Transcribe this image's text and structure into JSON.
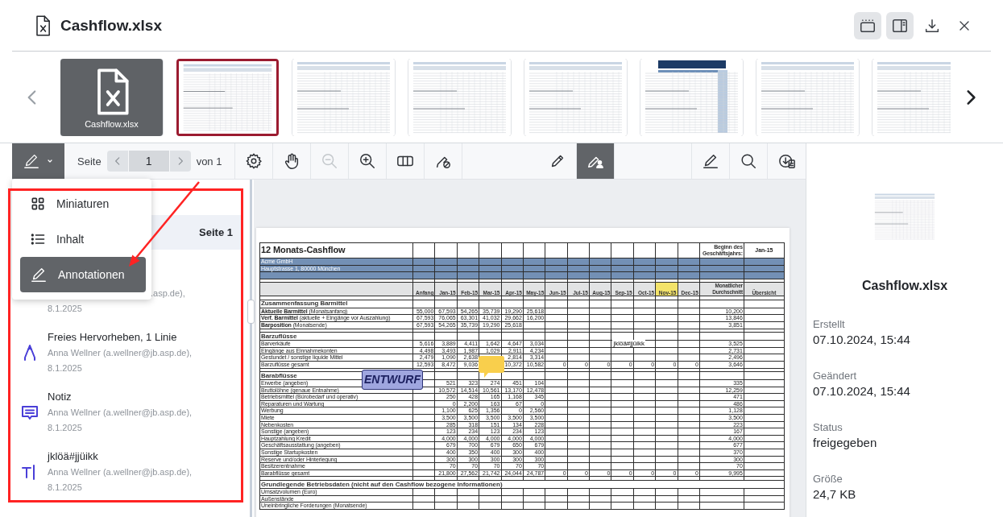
{
  "header": {
    "title": "Cashflow.xlsx",
    "toggles": [
      {
        "kind": "strip",
        "on": true
      },
      {
        "kind": "panel",
        "on": true
      }
    ]
  },
  "strip": {
    "items": [
      {
        "kind": "file",
        "label": "Cashflow.xlsx",
        "selected": false
      },
      {
        "kind": "sheet",
        "selected": true
      },
      {
        "kind": "sheet",
        "selected": false
      },
      {
        "kind": "sheet",
        "selected": false
      },
      {
        "kind": "sheet",
        "selected": false
      },
      {
        "kind": "banner",
        "selected": false
      },
      {
        "kind": "sheet",
        "selected": false
      },
      {
        "kind": "sheet",
        "selected": false
      }
    ]
  },
  "toolbar": {
    "mode": {
      "expanded": true
    },
    "page_label": "Seite",
    "page_value": "1",
    "page_total": "von 1",
    "groups": [
      {
        "tools": [
          {
            "kind": "settings",
            "disabled": false,
            "selected": false
          },
          {
            "kind": "hand",
            "disabled": false,
            "selected": false
          },
          {
            "kind": "zoom-out",
            "disabled": true,
            "selected": false
          },
          {
            "kind": "zoom-in",
            "disabled": false,
            "selected": false
          },
          {
            "kind": "columns",
            "disabled": false,
            "selected": false
          },
          {
            "kind": "pen-blocked",
            "disabled": false,
            "selected": false
          }
        ]
      },
      {
        "tools": [
          {
            "kind": "pencil",
            "disabled": false,
            "selected": false
          },
          {
            "kind": "pencil-person",
            "disabled": false,
            "selected": true
          }
        ]
      },
      {
        "tools": [
          {
            "kind": "pencil-line",
            "disabled": false,
            "selected": false
          },
          {
            "kind": "search",
            "disabled": false,
            "selected": false
          },
          {
            "kind": "download-document",
            "disabled": false,
            "selected": false
          }
        ]
      }
    ]
  },
  "menu": {
    "items": [
      {
        "kind": "grid",
        "label": "Miniaturen",
        "selected": false
      },
      {
        "kind": "list",
        "label": "Inhalt",
        "selected": false
      },
      {
        "kind": "pen",
        "label": "Annotationen",
        "selected": true
      }
    ]
  },
  "sidebar": {
    "page_header": "Seite 1",
    "annotations": [
      {
        "kind": "covered",
        "author": ".asp.de),",
        "date": "8.1.2025"
      },
      {
        "kind": "ink",
        "title": "Freies Hervorheben, 1 Linie",
        "author": "Anna Wellner (a.wellner@jb.asp.de),",
        "date": "8.1.2025"
      },
      {
        "kind": "note",
        "title": "Notiz",
        "author": "Anna Wellner (a.wellner@jb.asp.de),",
        "date": "8.1.2025"
      },
      {
        "kind": "text",
        "title": "jklöä#jjüikk",
        "author": "Anna Wellner (a.wellner@jb.asp.de),",
        "date": "8.1.2025"
      }
    ]
  },
  "sheet": {
    "rows": [
      {
        "kind": "title",
        "label": "12 Monats-Cashflow",
        "average": "Beginn des Geschäftsjahrs:",
        "overview": "Jan-15"
      },
      {
        "kind": "band",
        "label": "Acme GmbH"
      },
      {
        "kind": "band",
        "label": "Hauptstrasse 1, 80000 München"
      },
      {
        "kind": "band"
      },
      {
        "kind": "blank"
      },
      {
        "kind": "header",
        "cells": [
          {
            "text": "Anfang",
            "highlighted": false
          },
          {
            "text": "Jan-15",
            "highlighted": false
          },
          {
            "text": "Feb-15",
            "highlighted": false
          },
          {
            "text": "Mar-15",
            "highlighted": false
          },
          {
            "text": "Apr-15",
            "highlighted": false
          },
          {
            "text": "May-15",
            "highlighted": false
          },
          {
            "text": "Jun-15",
            "highlighted": false
          },
          {
            "text": "Jul-15",
            "highlighted": false
          },
          {
            "text": "Aug-15",
            "highlighted": false
          },
          {
            "text": "Sep-15",
            "highlighted": false
          },
          {
            "text": "Oct-15",
            "highlighted": false
          },
          {
            "text": "Nov-15",
            "highlighted": true
          },
          {
            "text": "Dec-15",
            "highlighted": false
          }
        ],
        "average": "Monatlicher Durchschnitt",
        "overview": "Übersicht"
      },
      {
        "kind": "blank"
      },
      {
        "kind": "section",
        "label": "Zusammenfassung Barmittel"
      },
      {
        "kind": "data",
        "label": "**Aktuelle Barmittel** (Monatsanfang)",
        "cells": [
          "55,000",
          "67,593",
          "54,265",
          "35,739",
          "19,290",
          "25,618",
          null,
          null,
          null,
          null,
          null,
          null,
          null
        ],
        "average": "10,200"
      },
      {
        "kind": "data",
        "label": "**Verf. Barmittel** (aktuelle + Eingänge vor Auszahlung)",
        "cells": [
          "67,593",
          "76,065",
          "63,301",
          "41,032",
          "29,662",
          "16,200",
          null,
          null,
          null,
          null,
          null,
          null,
          null
        ],
        "average": "13,846"
      },
      {
        "kind": "data",
        "label": "**Barposition** (Monatsende)",
        "cells": [
          "67,593",
          "54,265",
          "35,739",
          "19,290",
          "25,618",
          null,
          null,
          null,
          null,
          null,
          null,
          null,
          null
        ],
        "average": "3,851"
      },
      {
        "kind": "blank"
      },
      {
        "kind": "section",
        "label": "Barzuflüsse"
      },
      {
        "kind": "data",
        "label": "Barverkäufe",
        "cells": [
          "5,616",
          "3,889",
          "4,411",
          "1,642",
          "4,647",
          "3,034",
          null,
          null,
          null,
          null,
          null,
          null,
          null
        ],
        "average": "3,525"
      },
      {
        "kind": "data",
        "label": "Eingänge aus Einnahmekonten",
        "cells": [
          "4,498",
          "3,493",
          "1,987",
          "1,029",
          "2,911",
          "4,234",
          null,
          null,
          null,
          null,
          null,
          null,
          null
        ],
        "average": "2,731"
      },
      {
        "kind": "data",
        "label": "Gestundet / sonstige liquide Mittel",
        "cells": [
          "2,479",
          "1,090",
          "2,638",
          null,
          "2,814",
          "3,314",
          null,
          null,
          null,
          null,
          null,
          null,
          null
        ],
        "average": "2,496"
      },
      {
        "kind": "data",
        "label": "Barzuflüsse gesamt",
        "cells": [
          "12,593",
          "8,472",
          "9,036",
          null,
          "10,372",
          "10,582",
          "0",
          "0",
          "0",
          "0",
          "0",
          "0",
          "0"
        ],
        "average": "3,646"
      },
      {
        "kind": "blank"
      },
      {
        "kind": "section",
        "label": "Barabflüsse"
      },
      {
        "kind": "data",
        "label": "Erwerbe (angeben)",
        "cells": [
          null,
          "521",
          "323",
          "274",
          "451",
          "104",
          null,
          null,
          null,
          null,
          null,
          null,
          null
        ],
        "average": "335"
      },
      {
        "kind": "data",
        "label": "Bruttolöhne (genaue Entnahme)",
        "cells": [
          null,
          "10,572",
          "14,514",
          "10,561",
          "13,170",
          "12,478",
          null,
          null,
          null,
          null,
          null,
          null,
          null
        ],
        "average": "12,259"
      },
      {
        "kind": "data",
        "label": "Betriebsmittel (Bürobedarf und operativ)",
        "cells": [
          null,
          "250",
          "428",
          "165",
          "1,168",
          "345",
          null,
          null,
          null,
          null,
          null,
          null,
          null
        ],
        "average": "471"
      },
      {
        "kind": "data",
        "label": "Reparaturen und Wartung",
        "cells": [
          null,
          "0",
          "2,200",
          "163",
          "67",
          "0",
          null,
          null,
          null,
          null,
          null,
          null,
          null
        ],
        "average": "486"
      },
      {
        "kind": "data",
        "label": "Werbung",
        "cells": [
          null,
          "1,100",
          "625",
          "1,356",
          "0",
          "2,560",
          null,
          null,
          null,
          null,
          null,
          null,
          null
        ],
        "average": "1,128"
      },
      {
        "kind": "data",
        "label": "Miete",
        "cells": [
          null,
          "3,500",
          "3,500",
          "3,500",
          "3,500",
          "3,500",
          null,
          null,
          null,
          null,
          null,
          null,
          null
        ],
        "average": "3,500"
      },
      {
        "kind": "data",
        "label": "Nebenkosten",
        "cells": [
          null,
          "285",
          "318",
          "151",
          "134",
          "228",
          null,
          null,
          null,
          null,
          null,
          null,
          null
        ],
        "average": "223"
      },
      {
        "kind": "data",
        "label": "Sonstige (angeben)",
        "cells": [
          null,
          "123",
          "234",
          "123",
          "234",
          "123",
          null,
          null,
          null,
          null,
          null,
          null,
          null
        ],
        "average": "167"
      },
      {
        "kind": "data",
        "label": "Hauptzahlung Kredit",
        "cells": [
          null,
          "4,000",
          "4,000",
          "4,000",
          "4,000",
          "4,000",
          null,
          null,
          null,
          null,
          null,
          null,
          null
        ],
        "average": "4,000"
      },
      {
        "kind": "data",
        "label": "Geschäftsausstattung (angeben)",
        "cells": [
          null,
          "679",
          "700",
          "679",
          "650",
          "679",
          null,
          null,
          null,
          null,
          null,
          null,
          null
        ],
        "average": "677"
      },
      {
        "kind": "data",
        "label": "Sonstige Startupkosten",
        "cells": [
          null,
          "400",
          "350",
          "400",
          "300",
          "400",
          null,
          null,
          null,
          null,
          null,
          null,
          null
        ],
        "average": "370"
      },
      {
        "kind": "data",
        "label": "Reserve und/oder Hinterlegung",
        "cells": [
          null,
          "300",
          "300",
          "300",
          "300",
          "300",
          null,
          null,
          null,
          null,
          null,
          null,
          null
        ],
        "average": "300"
      },
      {
        "kind": "data",
        "label": "Besitzerentnahme",
        "cells": [
          null,
          "70",
          "70",
          "70",
          "70",
          "70",
          null,
          null,
          null,
          null,
          null,
          null,
          null
        ],
        "average": "70"
      },
      {
        "kind": "data",
        "label": "Barabflüsse gesamt",
        "cells": [
          null,
          "21,800",
          "27,562",
          "21,742",
          "24,044",
          "24,787",
          "0",
          "0",
          "0",
          "0",
          "0",
          "0",
          "0"
        ],
        "average": "9,995"
      },
      {
        "kind": "blank"
      },
      {
        "kind": "wide_section",
        "label": "Grundlegende Betriebsdaten (nicht auf den Cashflow bezogene Informationen)"
      },
      {
        "kind": "data",
        "label": "Umsatzvolumen (Euro)"
      },
      {
        "kind": "data",
        "label": "Außenstände"
      },
      {
        "kind": "data",
        "label": "Uneinbringliche Forderungen (Monatsende)"
      }
    ],
    "overlays": [
      {
        "kind": "stamp",
        "text": "ENTWURF"
      },
      {
        "kind": "note"
      },
      {
        "kind": "free_text",
        "text": "jklöä#jjüikk"
      }
    ]
  },
  "details": {
    "title": "Cashflow.xlsx",
    "fields": [
      {
        "label": "Erstellt",
        "value": "07.10.2024, 15:44"
      },
      {
        "label": "Geändert",
        "value": "07.10.2024, 15:44"
      },
      {
        "label": "Status",
        "value": "freigegeben"
      },
      {
        "label": "Größe",
        "value": "24,7 KB"
      }
    ]
  }
}
